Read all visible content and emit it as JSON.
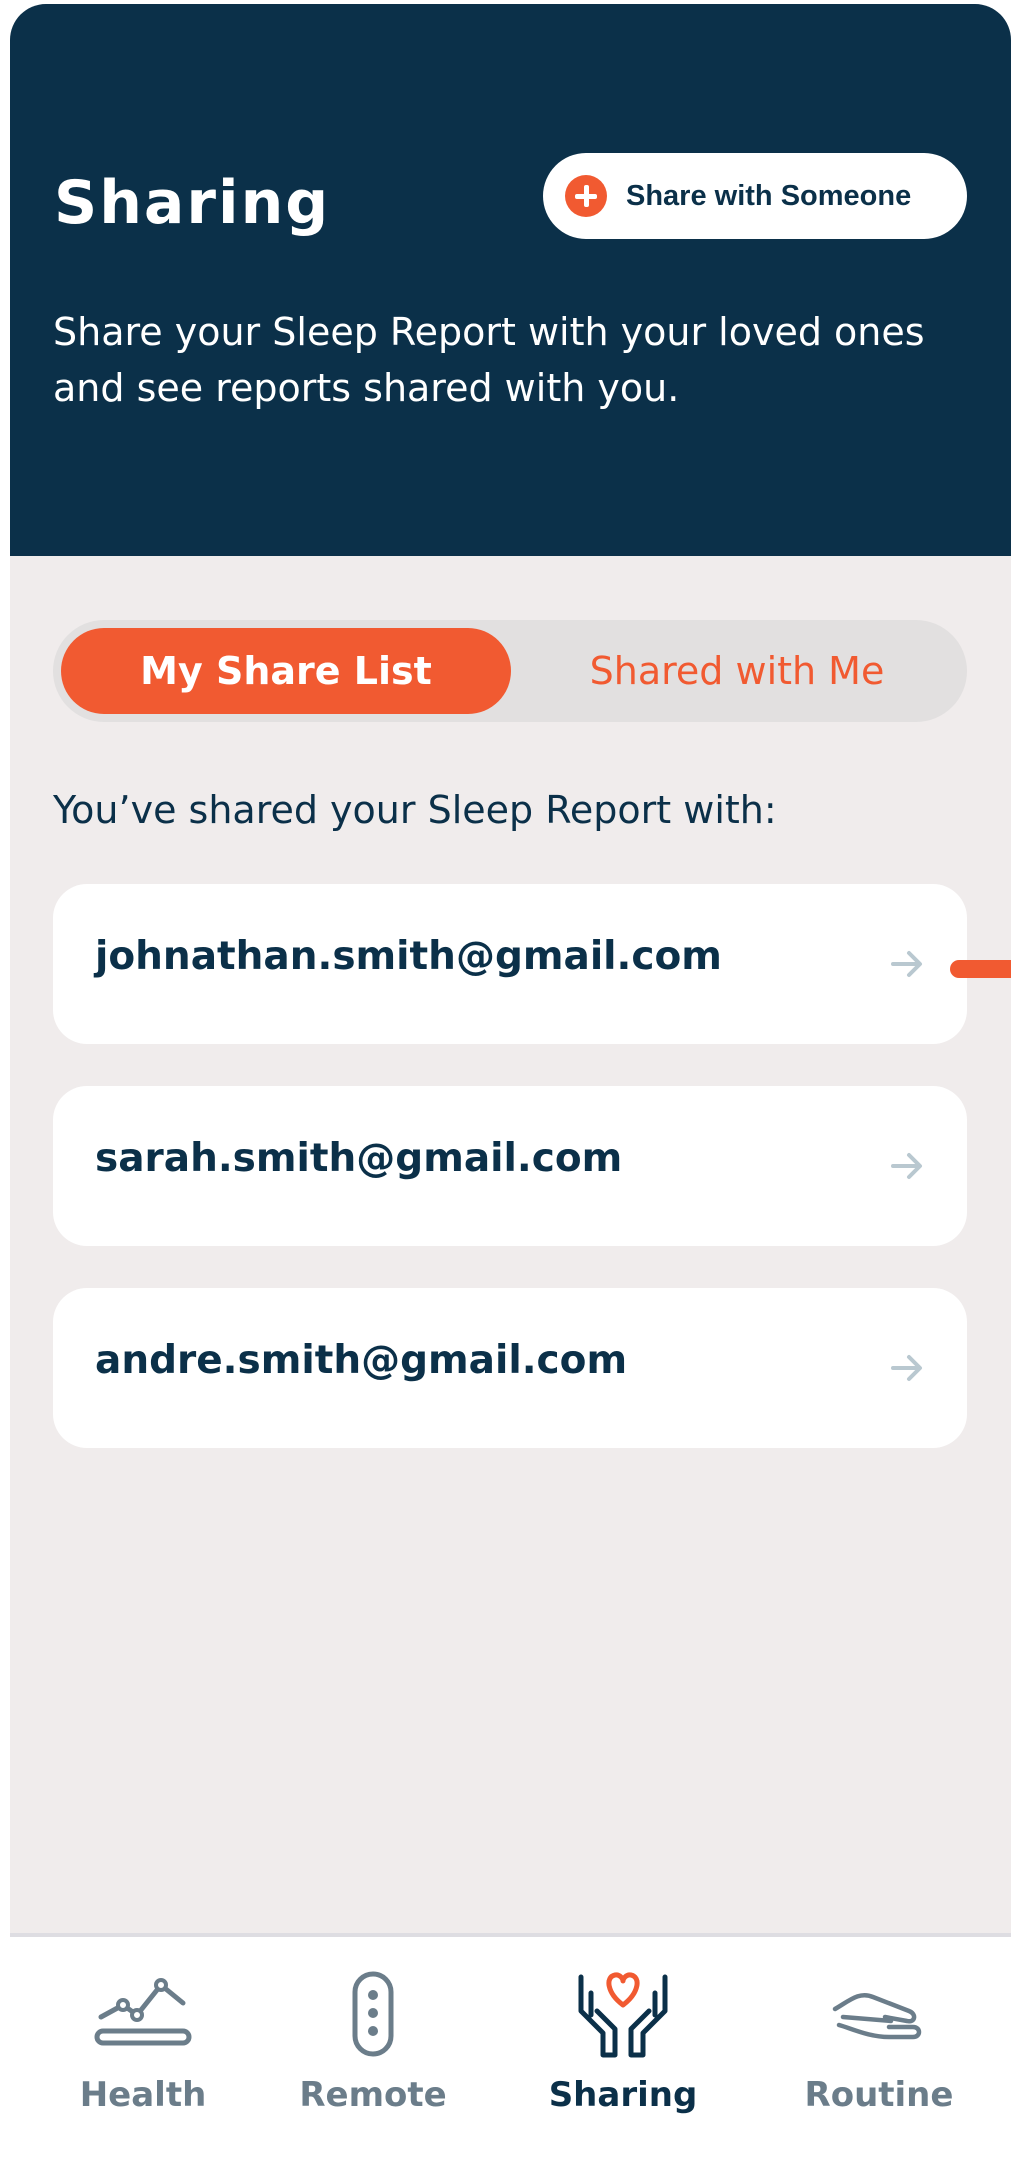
{
  "header": {
    "title": "Sharing",
    "share_button_label": "Share with Someone",
    "intro_text": "Share your Sleep Report with your loved ones and see reports shared with you."
  },
  "tabs": {
    "active": "My Share List",
    "inactive": "Shared with Me"
  },
  "list": {
    "heading": "You’ve shared your Sleep Report with:",
    "emails": [
      "johnathan.smith@gmail.com",
      "sarah.smith@gmail.com",
      "andre.smith@gmail.com"
    ]
  },
  "bottom_nav": [
    {
      "label": "Health",
      "icon": "health-chart-icon"
    },
    {
      "label": "Remote",
      "icon": "remote-icon"
    },
    {
      "label": "Sharing",
      "icon": "hands-heart-icon",
      "active": true
    },
    {
      "label": "Routine",
      "icon": "routine-hand-icon"
    }
  ],
  "colors": {
    "navy": "#0b3049",
    "accent": "#f15a31",
    "background": "#f0ecec"
  }
}
